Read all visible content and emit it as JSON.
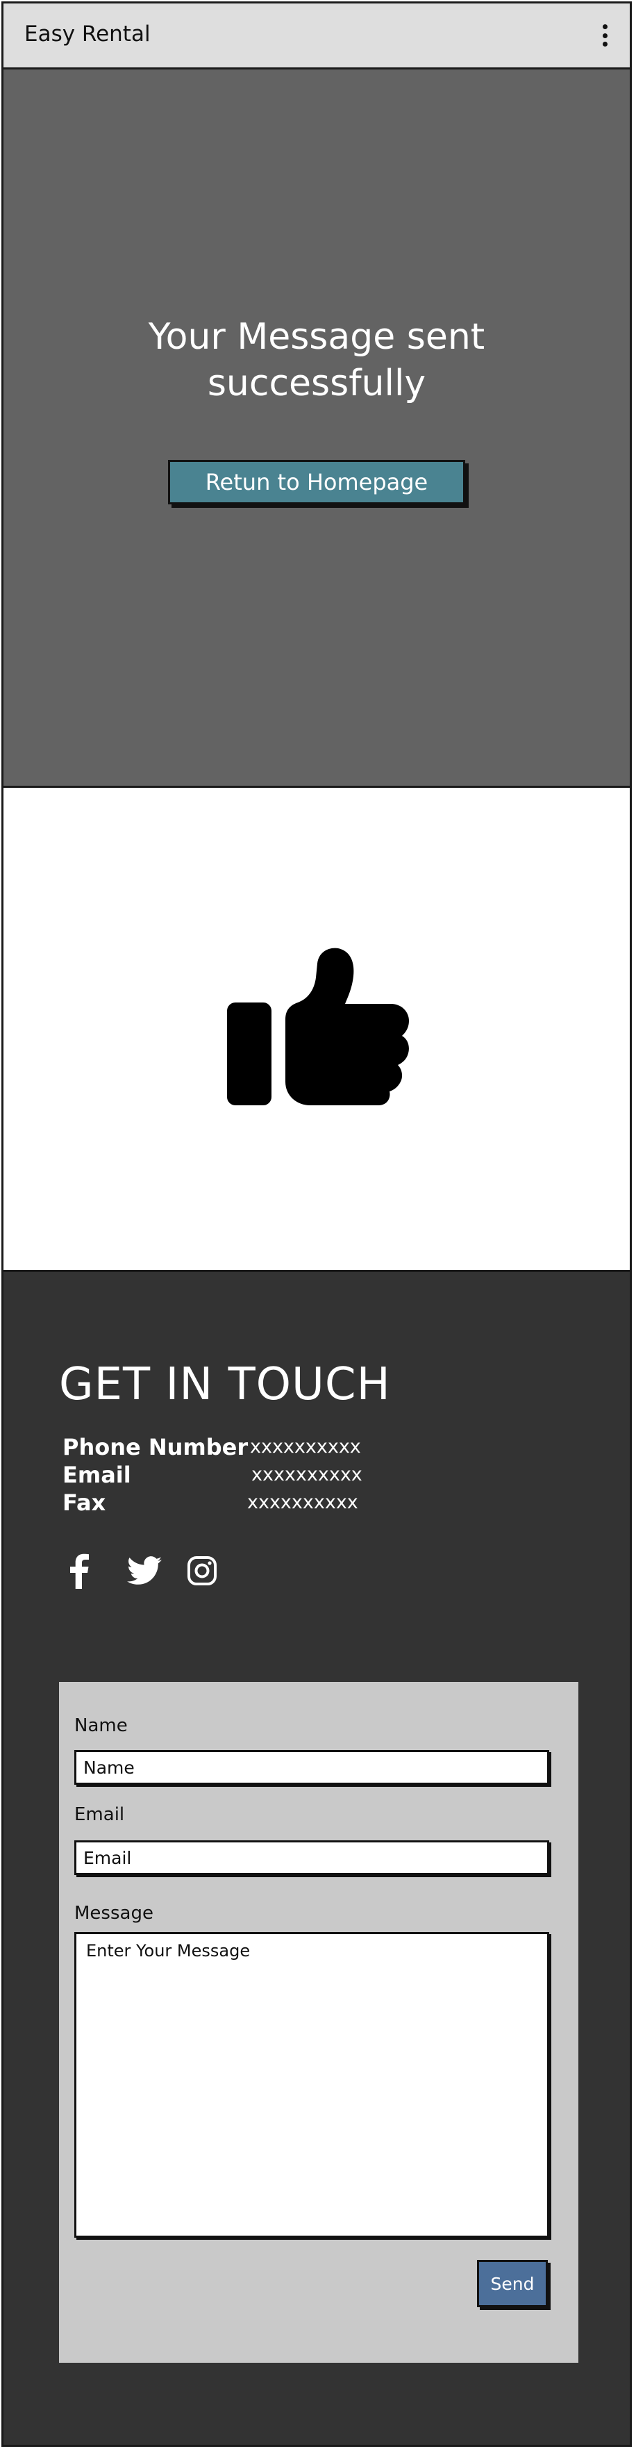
{
  "header": {
    "app_title": "Easy Rental",
    "menu_icon": "more-vertical-icon"
  },
  "success": {
    "message_line1": "Your Message sent",
    "message_line2": "successfully",
    "return_button": "Retun to Homepage",
    "icon": "thumbs-up-icon"
  },
  "contact": {
    "title": "GET IN TOUCH",
    "info": [
      {
        "label": "Phone Number",
        "value": "xxxxxxxxxx"
      },
      {
        "label": "Email",
        "value": "xxxxxxxxxx"
      },
      {
        "label": "Fax",
        "value": "xxxxxxxxxx"
      }
    ],
    "social_icons": [
      "facebook-icon",
      "twitter-icon",
      "instagram-icon"
    ],
    "form": {
      "name_label": "Name",
      "name_placeholder": "Name",
      "email_label": "Email",
      "email_placeholder": "Email",
      "message_label": "Message",
      "message_placeholder": "Enter Your Message",
      "send_button": "Send"
    }
  },
  "colors": {
    "header_bg": "#dedede",
    "success_bg": "#636363",
    "return_button": "#4a8391",
    "contact_bg": "#333333",
    "form_bg": "#c9c9c9",
    "send_button": "#4c6f9a"
  }
}
